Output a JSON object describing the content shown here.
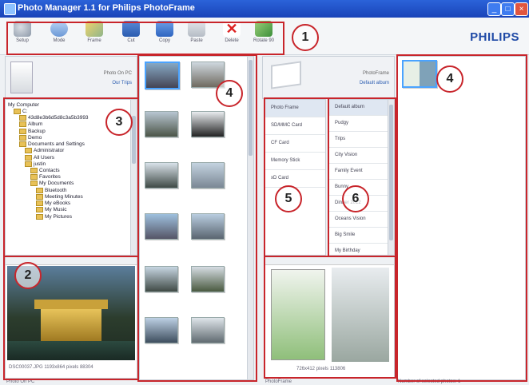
{
  "window": {
    "title": "Photo Manager 1.1 for Philips PhotoFrame",
    "minimize_icon": "minimize-icon",
    "maximize_icon": "maximize-icon",
    "close_icon": "close-icon"
  },
  "brand": "PHILIPS",
  "toolbar": {
    "buttons": [
      {
        "label": "Setup",
        "icon": "setup-icon"
      },
      {
        "label": "Mode",
        "icon": "mode-icon"
      },
      {
        "label": "Frame",
        "icon": "frame-icon"
      },
      {
        "label": "Cut",
        "icon": "cut-icon"
      },
      {
        "label": "Copy",
        "icon": "copy-icon"
      },
      {
        "label": "Paste",
        "icon": "paste-icon"
      },
      {
        "label": "Delete",
        "icon": "delete-icon"
      },
      {
        "label": "Rotate 90",
        "icon": "rotate-icon"
      }
    ]
  },
  "pc_panel": {
    "title": "Photo On PC",
    "subtitle": "Our Trips"
  },
  "frame_panel": {
    "title": "PhotoFrame",
    "subtitle": "Default album"
  },
  "tree": {
    "root": "My Computer",
    "items": [
      {
        "label": "C:",
        "level": 1
      },
      {
        "label": "43d8e3b6d5d8c3a5b3993",
        "level": 2
      },
      {
        "label": "Album",
        "level": 2
      },
      {
        "label": "Backup",
        "level": 2
      },
      {
        "label": "Demo",
        "level": 2
      },
      {
        "label": "Documents and Settings",
        "level": 2
      },
      {
        "label": "Administrator",
        "level": 3
      },
      {
        "label": "All Users",
        "level": 3
      },
      {
        "label": "justin",
        "level": 3
      },
      {
        "label": "Contacts",
        "level": 4
      },
      {
        "label": "Favorites",
        "level": 4
      },
      {
        "label": "My Documents",
        "level": 4
      },
      {
        "label": "Bluetooth",
        "level": 5
      },
      {
        "label": "Meeting Minutes",
        "level": 5
      },
      {
        "label": "My eBooks",
        "level": 5
      },
      {
        "label": "My Music",
        "level": 5
      },
      {
        "label": "My Pictures",
        "level": 5
      }
    ]
  },
  "sources": {
    "items": [
      "Photo Frame",
      "SD/MMC Card",
      "CF Card",
      "Memory Stick",
      "xD Card"
    ]
  },
  "albums": {
    "items": [
      "Default album",
      "Pudgy",
      "Trips",
      "City Vision",
      "Family Event",
      "Bunny",
      "Dinner 2012",
      "Oceans Vision",
      "Big Smile",
      "My Birthday"
    ]
  },
  "preview_left": {
    "info": "DSC00037.JPG  1193x864 pixels  88304"
  },
  "preview_right": {
    "info": "726x412 pixels  113806"
  },
  "status": {
    "left": "Photo On PC",
    "middle": "PhotoFrame",
    "right": "Number of selected photos: 1"
  },
  "callouts": [
    "1",
    "2",
    "3",
    "4",
    "4",
    "5",
    "6"
  ]
}
